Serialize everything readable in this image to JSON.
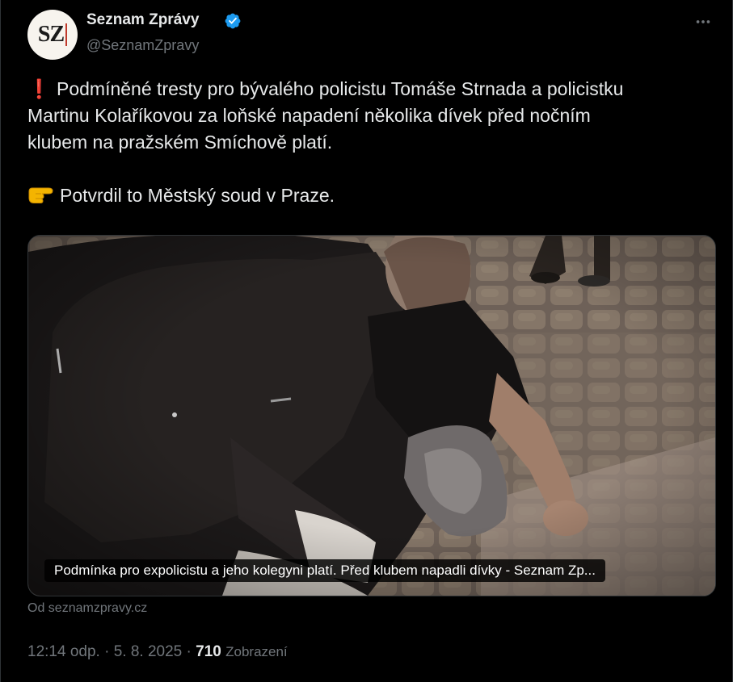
{
  "author": {
    "display_name": "Seznam Zprávy",
    "handle": "@SeznamZpravy",
    "avatar_text": "SZ",
    "verified_icon": "verified-badge-icon"
  },
  "tweet": {
    "line1": "Podmíněné tresty pro bývalého policistu Tomáše Strnada a policistku",
    "line2": "Martinu Kolaříkovou za loňské napadení několika dívek před nočním",
    "line3": "klubem na pražském Smíchově platí.",
    "line4": "Potvrdil to Městský soud v Praze.",
    "emoji1": "❗",
    "emoji2_icon": "backhand-index-pointing-right-icon"
  },
  "media": {
    "caption": "Podmínka pro expolicistu a jeho kolegyni platí. Před klubem napadli dívky - Seznam Zp..."
  },
  "source": "Od seznamzpravy.cz",
  "meta": {
    "time": "12:14 odp.",
    "sep1": " · ",
    "date": "5. 8. 2025",
    "sep2": " · ",
    "views": "710",
    "views_label": "Zobrazení"
  },
  "colors": {
    "background": "#000000",
    "text_primary": "#e7e9ea",
    "text_secondary": "#71767b",
    "verified": "#1d9bf0",
    "border": "#2f3336"
  }
}
